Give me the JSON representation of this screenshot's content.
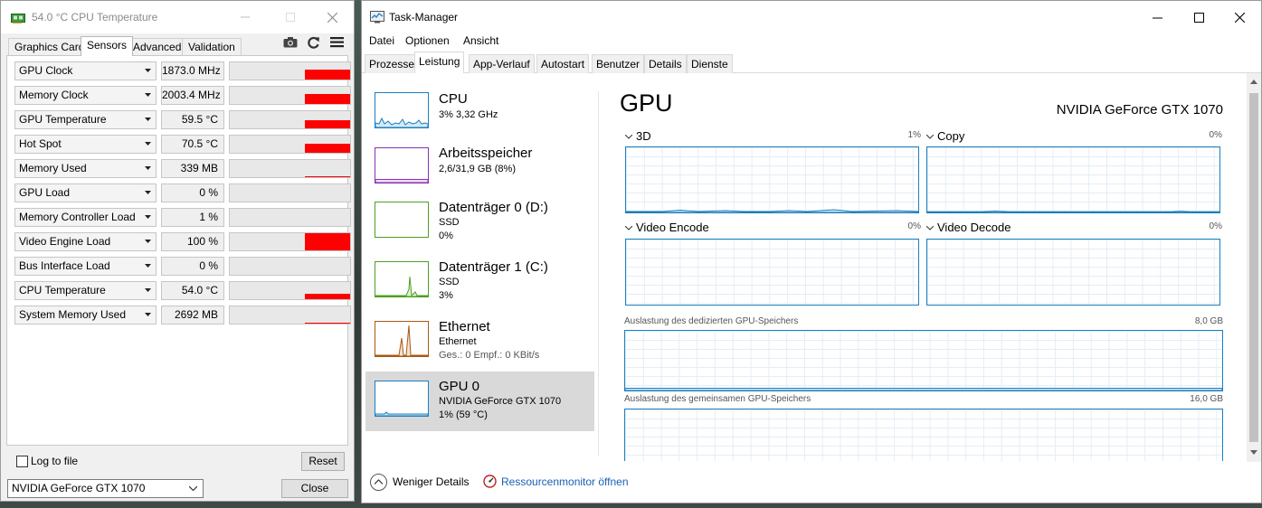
{
  "gpuz": {
    "title": "54.0 °C CPU Temperature",
    "tabs": [
      "Graphics Card",
      "Sensors",
      "Advanced",
      "Validation"
    ],
    "active_tab": "Sensors",
    "sensors": [
      {
        "name": "GPU Clock",
        "value": "1873.0 MHz",
        "level": 0.6
      },
      {
        "name": "Memory Clock",
        "value": "2003.4 MHz",
        "level": 0.6
      },
      {
        "name": "GPU Temperature",
        "value": "59.5 °C",
        "level": 0.45
      },
      {
        "name": "Hot Spot",
        "value": "70.5 °C",
        "level": 0.55
      },
      {
        "name": "Memory Used",
        "value": "339 MB",
        "level": 0.05
      },
      {
        "name": "GPU Load",
        "value": "0 %",
        "level": 0.0
      },
      {
        "name": "Memory Controller Load",
        "value": "1 %",
        "level": 0.0
      },
      {
        "name": "Video Engine Load",
        "value": "100 %",
        "level": 1.0
      },
      {
        "name": "Bus Interface Load",
        "value": "0 %",
        "level": 0.0
      },
      {
        "name": "CPU Temperature",
        "value": "54.0 °C",
        "level": 0.3
      },
      {
        "name": "System Memory Used",
        "value": "2692 MB",
        "level": 0.05
      }
    ],
    "log_to_file": "Log to file",
    "reset": "Reset",
    "gpu_select": "NVIDIA GeForce GTX 1070",
    "close": "Close",
    "sensor_color": "#ff0000"
  },
  "taskmanager": {
    "title": "Task-Manager",
    "menu": [
      "Datei",
      "Optionen",
      "Ansicht"
    ],
    "tabs": [
      "Prozesse",
      "Leistung",
      "App-Verlauf",
      "Autostart",
      "Benutzer",
      "Details",
      "Dienste"
    ],
    "active_tab": "Leistung",
    "sidebar": [
      {
        "title": "CPU",
        "line1": "3% 3,32 GHz",
        "line2": "",
        "color": "#1b7fbf"
      },
      {
        "title": "Arbeitsspeicher",
        "line1": "2,6/31,9 GB (8%)",
        "line2": "",
        "color": "#8b2fb3"
      },
      {
        "title": "Datenträger 0 (D:)",
        "line1": "SSD",
        "line2": "0%",
        "color": "#4da023"
      },
      {
        "title": "Datenträger 1 (C:)",
        "line1": "SSD",
        "line2": "3%",
        "color": "#4da023"
      },
      {
        "title": "Ethernet",
        "line1": "Ethernet",
        "line2": "Ges.: 0 Empf.: 0 KBit/s",
        "color": "#a75a16"
      },
      {
        "title": "GPU 0",
        "line1": "NVIDIA GeForce GTX 1070",
        "line2": "1% (59 °C)",
        "color": "#1b7fbf"
      }
    ],
    "selected_item": "GPU 0",
    "gpu": {
      "heading": "GPU",
      "name": "NVIDIA GeForce GTX 1070",
      "engines": [
        {
          "label": "3D",
          "percent": "1%"
        },
        {
          "label": "Copy",
          "percent": "0%"
        },
        {
          "label": "Video Encode",
          "percent": "0%"
        },
        {
          "label": "Video Decode",
          "percent": "0%"
        }
      ],
      "dedicated_label": "Auslastung des dedizierten GPU-Speichers",
      "dedicated_max": "8,0 GB",
      "shared_label": "Auslastung des gemeinsamen GPU-Speichers",
      "shared_max": "16,0 GB"
    },
    "footer": {
      "less_details": "Weniger Details",
      "resource_monitor": "Ressourcenmonitor öffnen"
    }
  }
}
